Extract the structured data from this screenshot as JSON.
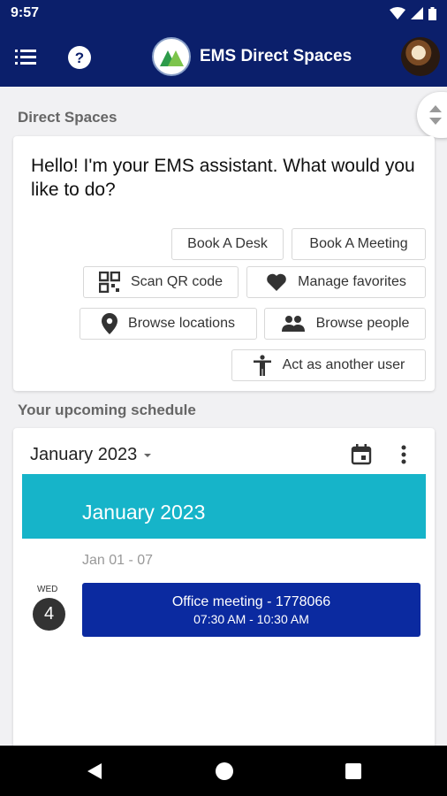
{
  "status_bar": {
    "time": "9:57"
  },
  "app_bar": {
    "title": "EMS Direct Spaces"
  },
  "sections": {
    "direct_spaces": "Direct Spaces",
    "upcoming": "Your upcoming schedule"
  },
  "assistant": {
    "greeting": "Hello! I'm your EMS assistant. What would you like to do?",
    "actions": {
      "book_desk": "Book A Desk",
      "book_meeting": "Book A Meeting",
      "scan_qr": "Scan QR code",
      "manage_favorites": "Manage favorites",
      "browse_locations": "Browse locations",
      "browse_people": "Browse people",
      "act_as_user": "Act as another user"
    }
  },
  "schedule": {
    "month_select": "January 2023",
    "month_banner": "January 2023",
    "week_range": "Jan 01 - 07",
    "day": {
      "weekday": "WED",
      "number": "4"
    },
    "event": {
      "title": "Office meeting - 1778066",
      "time": "07:30 AM - 10:30 AM"
    }
  },
  "colors": {
    "primary": "#0b1f6b",
    "banner": "#16b4c9",
    "event": "#0b2aa0"
  }
}
